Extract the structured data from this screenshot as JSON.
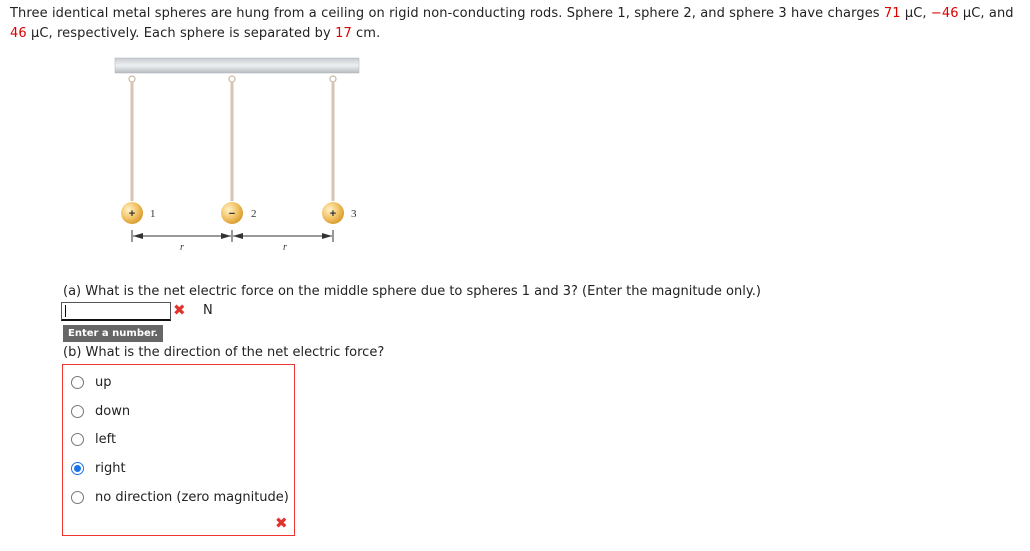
{
  "problem": {
    "intro": "Three identical metal spheres are hung from a ceiling on rigid non-conducting rods. Sphere 1, sphere 2, and sphere 3 have charges ",
    "q1": "71",
    "q1_unit": " µC, ",
    "q2": "−46",
    "q2_unit": " µC, and ",
    "q3": "46",
    "q3_unit": " µC, respectively. Each sphere is separated by ",
    "sep": "17",
    "sep_unit": " cm."
  },
  "figure": {
    "spheres": [
      {
        "label": "1",
        "sign": "+"
      },
      {
        "label": "2",
        "sign": "−"
      },
      {
        "label": "3",
        "sign": "+"
      }
    ],
    "distance_labels": [
      "r",
      "r"
    ]
  },
  "part_a": {
    "question": "(a) What is the net electric force on the middle sphere due to spheres 1 and 3? (Enter the magnitude only.)",
    "value": "",
    "unit": "N",
    "status_icon": "x-mark-icon",
    "tooltip": "Enter a number."
  },
  "part_b": {
    "question": "(b) What is the direction of the net electric force?",
    "options": [
      "up",
      "down",
      "left",
      "right",
      "no direction (zero magnitude)"
    ],
    "selected": "right",
    "status_icon": "x-mark-icon"
  },
  "colors": {
    "highlight": "#e00000",
    "error": "#e0332b",
    "radio_selected": "#1a73e8"
  }
}
